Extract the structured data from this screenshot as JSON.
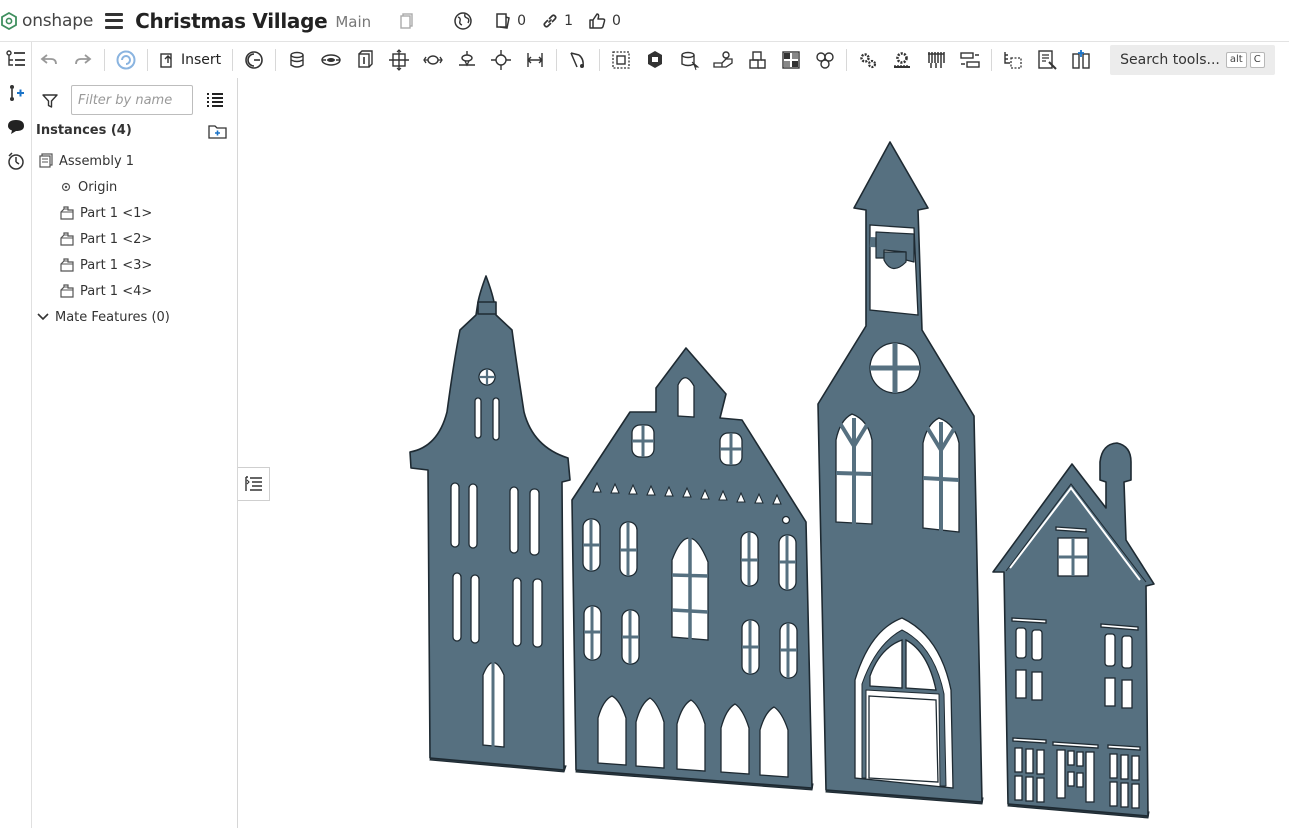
{
  "app": {
    "logo_text": "onshape",
    "title": "Christmas Village",
    "branch": "Main"
  },
  "header": {
    "versions_count": "0",
    "links_count": "1",
    "likes_count": "0"
  },
  "toolbar": {
    "insert_label": "Insert",
    "search_label": "Search tools...",
    "search_key1": "alt",
    "search_key2": "C"
  },
  "panel": {
    "filter_placeholder": "Filter by name",
    "instances_header": "Instances (4)",
    "tree": {
      "assembly": "Assembly 1",
      "origin": "Origin",
      "parts": [
        "Part 1 <1>",
        "Part 1 <2>",
        "Part 1 <3>",
        "Part 1 <4>"
      ],
      "mate_features": "Mate Features (0)"
    }
  },
  "colors": {
    "model_fill": "#567080",
    "model_edge": "#1e2a32",
    "accent": "#1a73c8"
  },
  "icons": {
    "logo": "onshape-logo-icon",
    "globe": "globe-icon",
    "versions": "versions-icon",
    "link": "link-icon",
    "like": "thumbs-up-icon"
  }
}
